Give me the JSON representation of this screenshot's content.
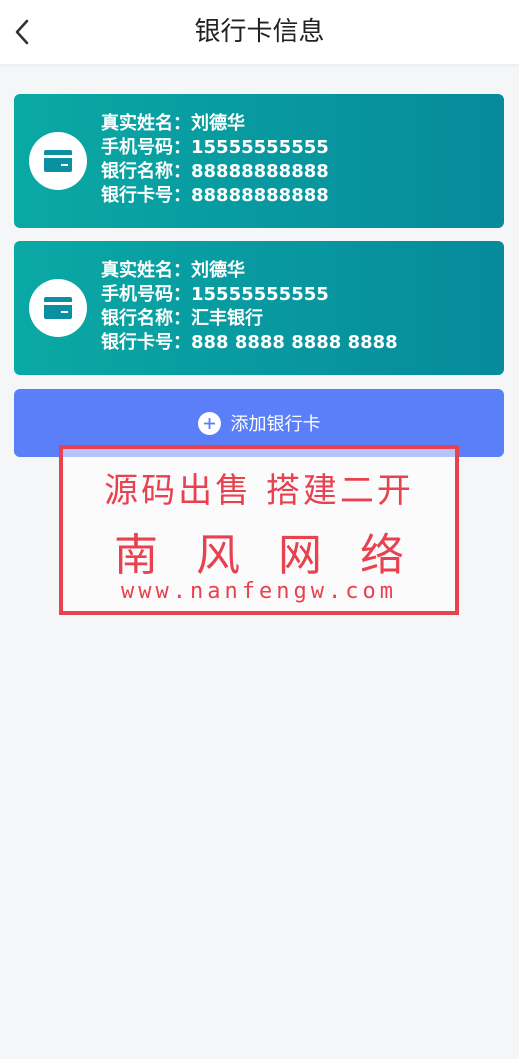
{
  "header": {
    "title": "银行卡信息",
    "back_icon": "chevron-left-icon"
  },
  "cards": [
    {
      "icon": "credit-card-icon",
      "name_label": "真实姓名：",
      "name": "刘德华",
      "phone_label": "手机号码：",
      "phone": "15555555555",
      "bank_label": "银行名称：",
      "bank": "88888888888",
      "cardno_label": "银行卡号：",
      "cardno": "88888888888"
    },
    {
      "icon": "credit-card-icon",
      "name_label": "真实姓名：",
      "name": "刘德华",
      "phone_label": "手机号码：",
      "phone": "15555555555",
      "bank_label": "银行名称：",
      "bank": "汇丰银行",
      "cardno_label": "银行卡号：",
      "cardno": "888 8888 8888 8888"
    }
  ],
  "add_button": {
    "label": "添加银行卡",
    "icon": "plus-circle-icon"
  },
  "watermark": {
    "line1": "源码出售 搭建二开",
    "line2": "南风网络",
    "line3": "www.nanfengw.com"
  },
  "colors": {
    "card_gradient_start": "#0aa9a4",
    "card_gradient_end": "#068a9c",
    "add_button": "#5b7ff8",
    "watermark": "#e8414f",
    "background": "#f5f6f8"
  }
}
